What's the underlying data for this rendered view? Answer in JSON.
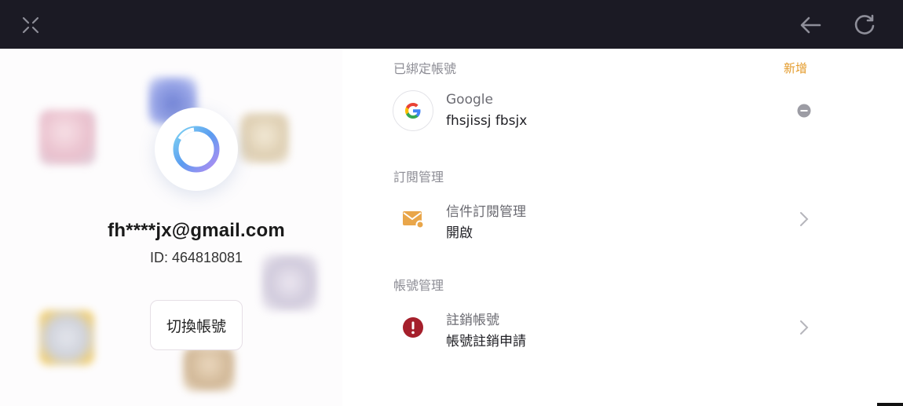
{
  "toolbar": {
    "close_icon": "close-x-icon",
    "back_icon": "arrow-left-icon",
    "refresh_icon": "refresh-icon"
  },
  "profile": {
    "email": "fh****jx@gmail.com",
    "id_text": "ID: 464818081",
    "switch_label": "切換帳號"
  },
  "bound_accounts": {
    "title": "已綁定帳號",
    "add_label": "新增",
    "items": [
      {
        "provider": "Google",
        "name": "fhsjissj fbsjx",
        "icon": "google-icon",
        "action_icon": "remove-icon"
      }
    ]
  },
  "subscription": {
    "title": "訂閱管理",
    "items": [
      {
        "label": "信件訂閱管理",
        "value": "開啟",
        "icon": "mail-icon"
      }
    ]
  },
  "account_management": {
    "title": "帳號管理",
    "items": [
      {
        "label": "註銷帳號",
        "value": "帳號註銷申請",
        "icon": "alert-icon"
      }
    ]
  },
  "colors": {
    "topbar": "#1b1a24",
    "accent": "#e49b2b",
    "alert": "#a51f2b",
    "mail": "#e9a64a"
  }
}
